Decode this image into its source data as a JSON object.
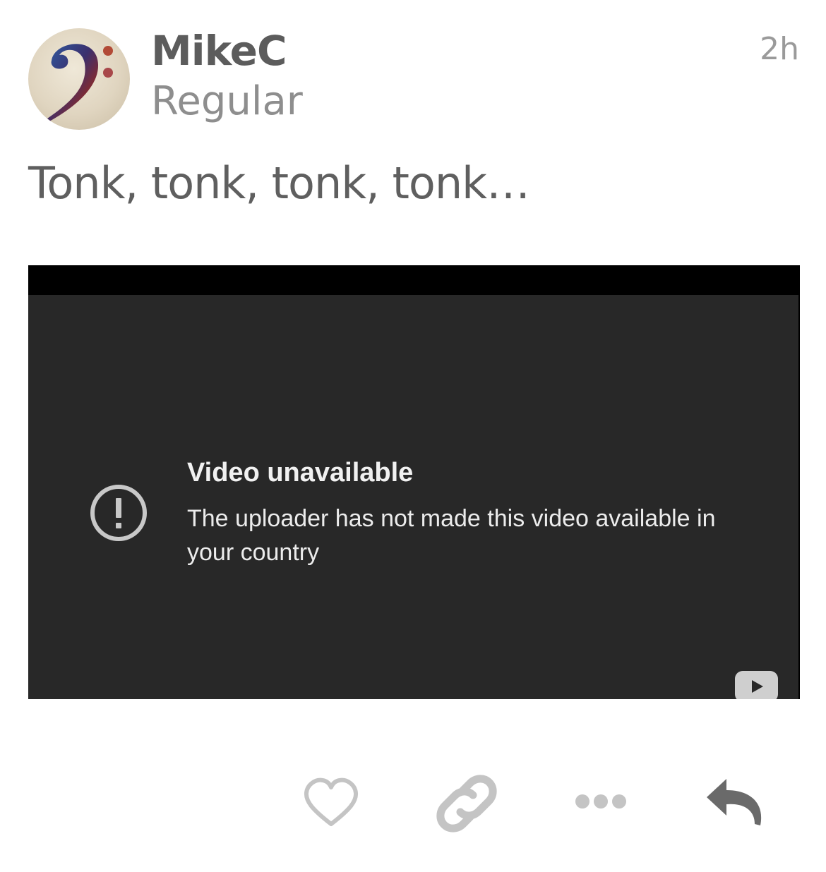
{
  "post": {
    "author": {
      "username": "MikeC",
      "title": "Regular",
      "avatar_icon": "bass-clef-icon"
    },
    "time_ago": "2h",
    "text": "Tonk, tonk, tonk, tonk…"
  },
  "embed": {
    "error_title": "Video unavailable",
    "error_message": "The uploader has not made this video available in your country",
    "alert_icon": "alert-circle-icon",
    "logo_icon": "youtube-logo-icon"
  },
  "actions": {
    "like_icon": "heart-icon",
    "link_icon": "link-icon",
    "more_icon": "ellipsis-icon",
    "reply_icon": "reply-arrow-icon"
  },
  "colors": {
    "video_background": "#282828",
    "icon_gray": "#c4c4c4",
    "reply_icon": "#6a6a6a"
  }
}
